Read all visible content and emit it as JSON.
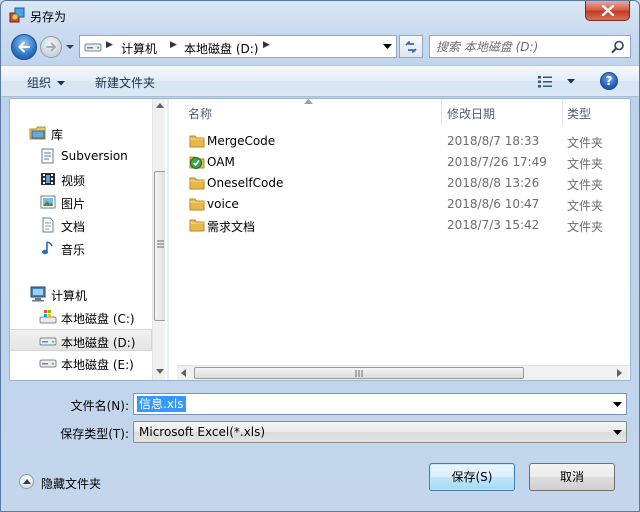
{
  "window": {
    "title": "另存为"
  },
  "nav": {
    "breadcrumbs": [
      "计算机",
      "本地磁盘 (D:)"
    ],
    "search_placeholder": "搜索 本地磁盘 (D:)"
  },
  "toolbar": {
    "organize": "组织",
    "new_folder": "新建文件夹"
  },
  "sidebar": {
    "items": [
      {
        "label": "库",
        "icon": "library-icon"
      },
      {
        "label": "Subversion",
        "icon": "document-library-icon"
      },
      {
        "label": "视频",
        "icon": "video-icon"
      },
      {
        "label": "图片",
        "icon": "picture-icon"
      },
      {
        "label": "文档",
        "icon": "document-icon"
      },
      {
        "label": "音乐",
        "icon": "music-icon"
      },
      {
        "label": "计算机",
        "icon": "computer-icon"
      },
      {
        "label": "本地磁盘 (C:)",
        "icon": "system-drive-icon"
      },
      {
        "label": "本地磁盘 (D:)",
        "icon": "drive-icon"
      },
      {
        "label": "本地磁盘 (E:)",
        "icon": "drive-icon"
      }
    ]
  },
  "files": {
    "columns": [
      "名称",
      "修改日期",
      "类型"
    ],
    "rows": [
      {
        "name": "MergeCode",
        "date": "2018/8/7 18:33",
        "type": "文件夹",
        "icon": "folder-icon"
      },
      {
        "name": "OAM",
        "date": "2018/7/26 17:49",
        "type": "文件夹",
        "icon": "folder-synced-icon"
      },
      {
        "name": "OneselfCode",
        "date": "2018/8/8 13:26",
        "type": "文件夹",
        "icon": "folder-icon"
      },
      {
        "name": "voice",
        "date": "2018/8/6 10:47",
        "type": "文件夹",
        "icon": "folder-icon"
      },
      {
        "name": "需求文档",
        "date": "2018/7/3 15:42",
        "type": "文件夹",
        "icon": "folder-icon"
      }
    ]
  },
  "form": {
    "filename_label": "文件名(N):",
    "filename_value": "信息.xls",
    "filetype_label": "保存类型(T):",
    "filetype_value": "Microsoft Excel(*.xls)"
  },
  "footer": {
    "hide_folders": "隐藏文件夹",
    "save": "保存(S)",
    "cancel": "取消"
  },
  "colors": {
    "accent": "#3399ff",
    "close": "#c23c24",
    "folder": "#e8b84a"
  }
}
